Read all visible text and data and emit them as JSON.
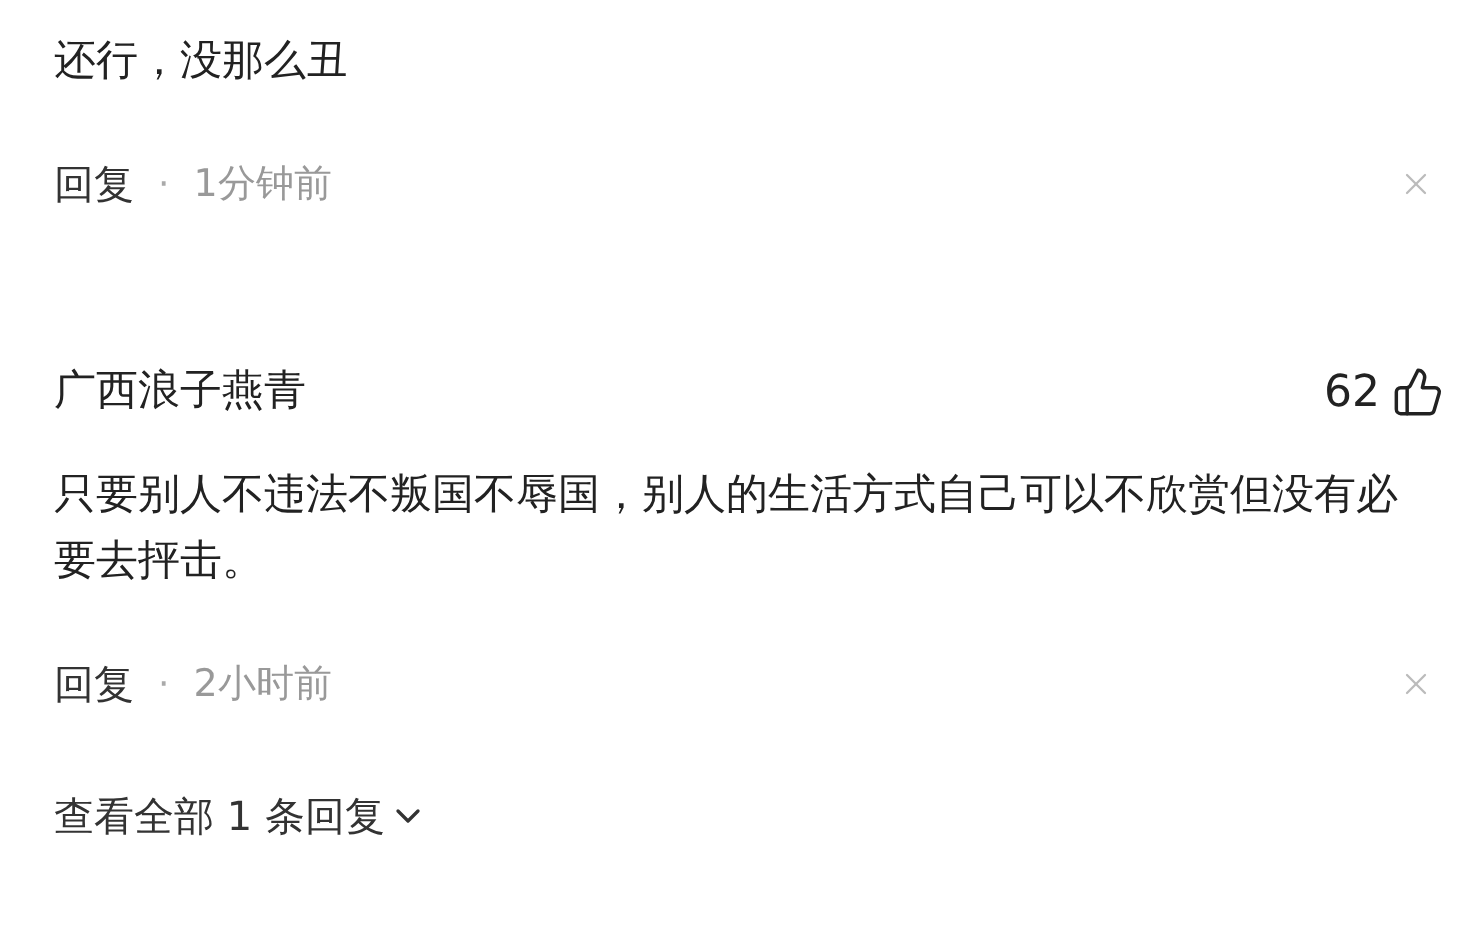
{
  "comments": [
    {
      "text": "还行，没那么丑",
      "reply": "回复",
      "dot": "·",
      "time": "1分钟前"
    },
    {
      "author": "广西浪子燕青",
      "likes": "62",
      "text": "只要别人不违法不叛国不辱国，别人的生活方式自己可以不欣赏但没有必要去抨击。",
      "reply": "回复",
      "dot": "·",
      "time": "2小时前"
    }
  ],
  "view_replies": "查看全部 1 条回复"
}
